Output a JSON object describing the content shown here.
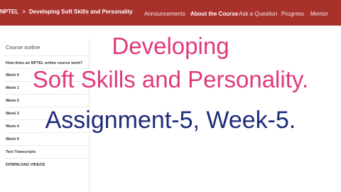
{
  "header": {
    "breadcrumb": [
      "NPTEL",
      "Developing Soft Skills and Personality"
    ],
    "breadcrumb_separator": ">",
    "nav": [
      "Announcements",
      "About the Course",
      "Ask a Question",
      "Progress",
      "Mentor"
    ],
    "active_nav": "About the Course"
  },
  "sidebar": {
    "heading": "Course outline",
    "items": [
      "How does an NPTEL online course work?",
      "Week 0",
      "Week 1",
      "Week 2",
      "Week 3",
      "Week 4",
      "Week 5",
      "Text Transcripts",
      "DOWNLOAD VIDEOS"
    ]
  },
  "overlay": {
    "line1": "Developing",
    "line2": "Soft Skills and Personality.",
    "line3": "Assignment-5, Week-5."
  },
  "colors": {
    "header_bg": "#a8312c",
    "title_pink": "#e0397a",
    "title_navy": "#1f2b7a"
  }
}
